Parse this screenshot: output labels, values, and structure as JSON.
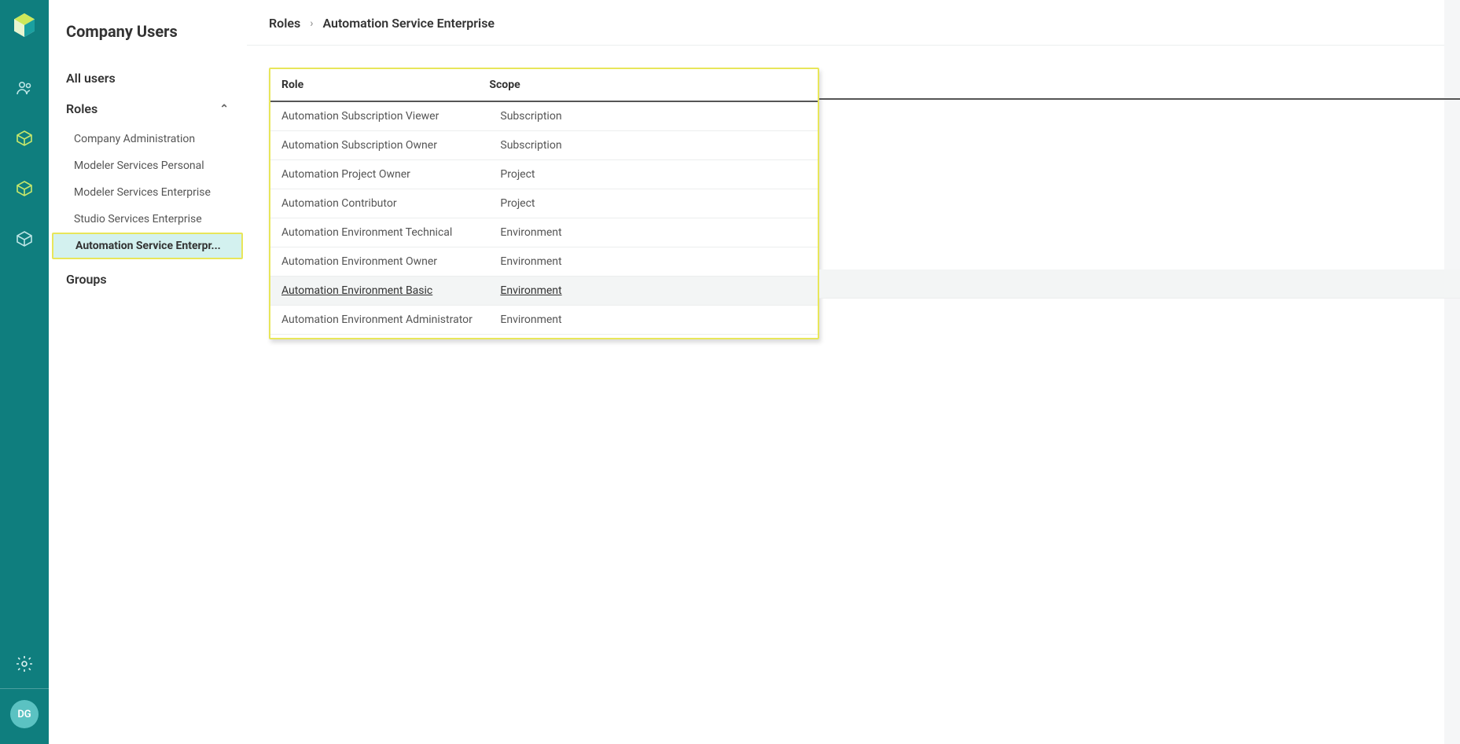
{
  "rail": {
    "avatar_initials": "DG"
  },
  "sidebar": {
    "title": "Company Users",
    "all_users": "All users",
    "roles_label": "Roles",
    "groups_label": "Groups",
    "roles": [
      {
        "label": "Company Administration"
      },
      {
        "label": "Modeler Services Personal"
      },
      {
        "label": "Modeler Services Enterprise"
      },
      {
        "label": "Studio Services Enterprise"
      },
      {
        "label": "Automation Service Enterpr..."
      }
    ]
  },
  "breadcrumb": {
    "root": "Roles",
    "current": "Automation Service Enterprise"
  },
  "table": {
    "col_role": "Role",
    "col_scope": "Scope",
    "rows": [
      {
        "role": "Automation Subscription Viewer",
        "scope": "Subscription"
      },
      {
        "role": "Automation Subscription Owner",
        "scope": "Subscription"
      },
      {
        "role": "Automation Project Owner",
        "scope": "Project"
      },
      {
        "role": "Automation Contributor",
        "scope": "Project"
      },
      {
        "role": "Automation Environment Technical",
        "scope": "Environment"
      },
      {
        "role": "Automation Environment Owner",
        "scope": "Environment"
      },
      {
        "role": "Automation Environment Basic",
        "scope": "Environment"
      },
      {
        "role": "Automation Environment Administrator",
        "scope": "Environment"
      }
    ]
  }
}
